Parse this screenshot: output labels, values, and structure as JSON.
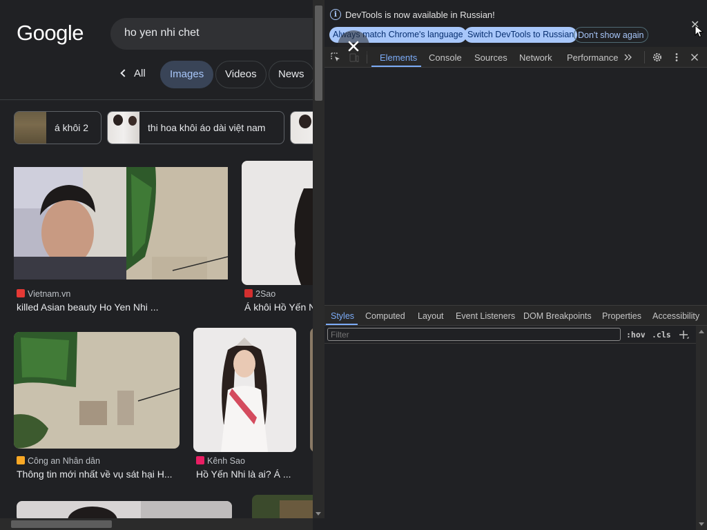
{
  "google": {
    "logo": "Google",
    "search_query": "ho yen nhi chet",
    "filters": {
      "all": "All",
      "images": "Images",
      "videos": "Videos",
      "news": "News"
    },
    "related": [
      {
        "label": "á khôi 2"
      },
      {
        "label": "thi hoa khôi áo dài việt nam"
      }
    ],
    "results": [
      {
        "source": "Vietnam.vn",
        "title": "killed Asian beauty Ho Yen Nhi ...",
        "fav_color": "#e53935"
      },
      {
        "source": "2Sao",
        "title": "Á khôi Hồ Yến N",
        "fav_color": "#d32f2f"
      },
      {
        "source": "Công an Nhân dân",
        "title": "Thông tin mới nhất về vụ sát hại H...",
        "fav_color": "#f9a825"
      },
      {
        "source": "Kênh Sao",
        "title": "Hồ Yến Nhi là ai? Á ...",
        "fav_color": "#e91e63"
      }
    ]
  },
  "devtools": {
    "infobar": {
      "message": "DevTools is now available in Russian!",
      "btn_match": "Always match Chrome's language",
      "btn_switch": "Switch DevTools to Russian",
      "btn_dont_show": "Don't show again"
    },
    "tabs": {
      "elements": "Elements",
      "console": "Console",
      "sources": "Sources",
      "network": "Network",
      "performance": "Performance"
    },
    "subtabs": {
      "styles": "Styles",
      "computed": "Computed",
      "layout": "Layout",
      "event_listeners": "Event Listeners",
      "dom_breakpoints": "DOM Breakpoints",
      "properties": "Properties",
      "accessibility": "Accessibility"
    },
    "filter_placeholder": "Filter",
    "hov": ":hov",
    "cls": ".cls"
  }
}
